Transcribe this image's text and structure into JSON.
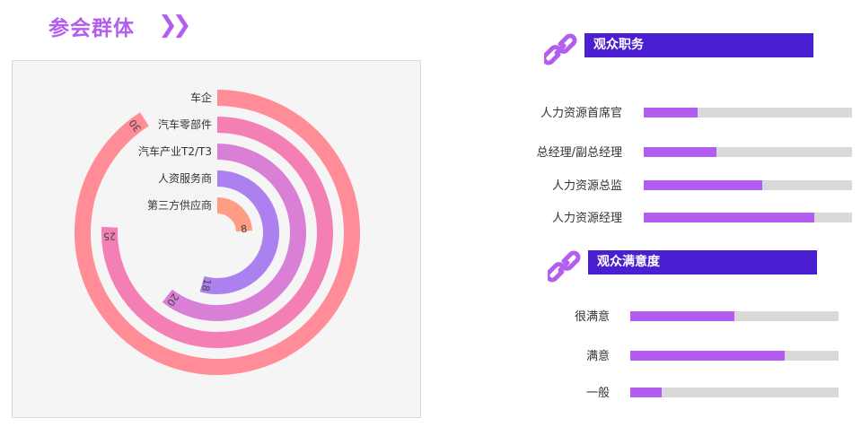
{
  "header": {
    "title": "参会群体",
    "arrow_icon": "double-chevron-right-icon"
  },
  "chart_data": {
    "type": "radial-bar",
    "categories": [
      "车企",
      "汽车零部件",
      "汽车产业T2/T3",
      "人资服务商",
      "第三方供应商"
    ],
    "values": [
      30,
      25,
      20,
      18,
      8
    ],
    "value_labels": [
      "30",
      "25",
      "20",
      "18",
      "8"
    ],
    "max": 33,
    "colors": [
      "#ff8c96",
      "#f47fb5",
      "#d97fd6",
      "#ac80ef",
      "#ff9c84"
    ]
  },
  "roles": {
    "title": "观众职务",
    "icon": "link-icon",
    "items": [
      {
        "label": "人力资源首席官",
        "value": 0.26
      },
      {
        "label": "总经理/副总经理",
        "value": 0.35
      },
      {
        "label": "人力资源总监",
        "value": 0.57
      },
      {
        "label": "人力资源经理",
        "value": 0.82
      }
    ]
  },
  "satisfaction": {
    "title": "观众满意度",
    "icon": "link-icon",
    "items": [
      {
        "label": "很满意",
        "value": 0.5
      },
      {
        "label": "满意",
        "value": 0.74
      },
      {
        "label": "一般",
        "value": 0.15
      }
    ]
  },
  "colors": {
    "accent": "#b45ef0",
    "header_bar": "#4a1fd1",
    "bar_fill": "#b35cf2",
    "track": "#d9d9d9"
  }
}
